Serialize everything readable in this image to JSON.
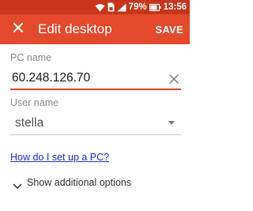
{
  "status_bar": {
    "battery_text": "79%",
    "time": "13:56",
    "icons": [
      "wifi-icon",
      "cellular-signal-icon",
      "sim-card-icon",
      "battery-icon"
    ]
  },
  "app_bar": {
    "title": "Edit desktop",
    "save_label": "SAVE",
    "close_icon": "close-icon",
    "background_color": "#e24a2b"
  },
  "form": {
    "pc_name": {
      "label": "PC name",
      "value": "60.248.126.70",
      "accent_color": "#e24a2b"
    },
    "user_name": {
      "label": "User name",
      "selected": "stella"
    },
    "help_link": "How do I set up a PC?",
    "additional_options": "Show additional options"
  }
}
